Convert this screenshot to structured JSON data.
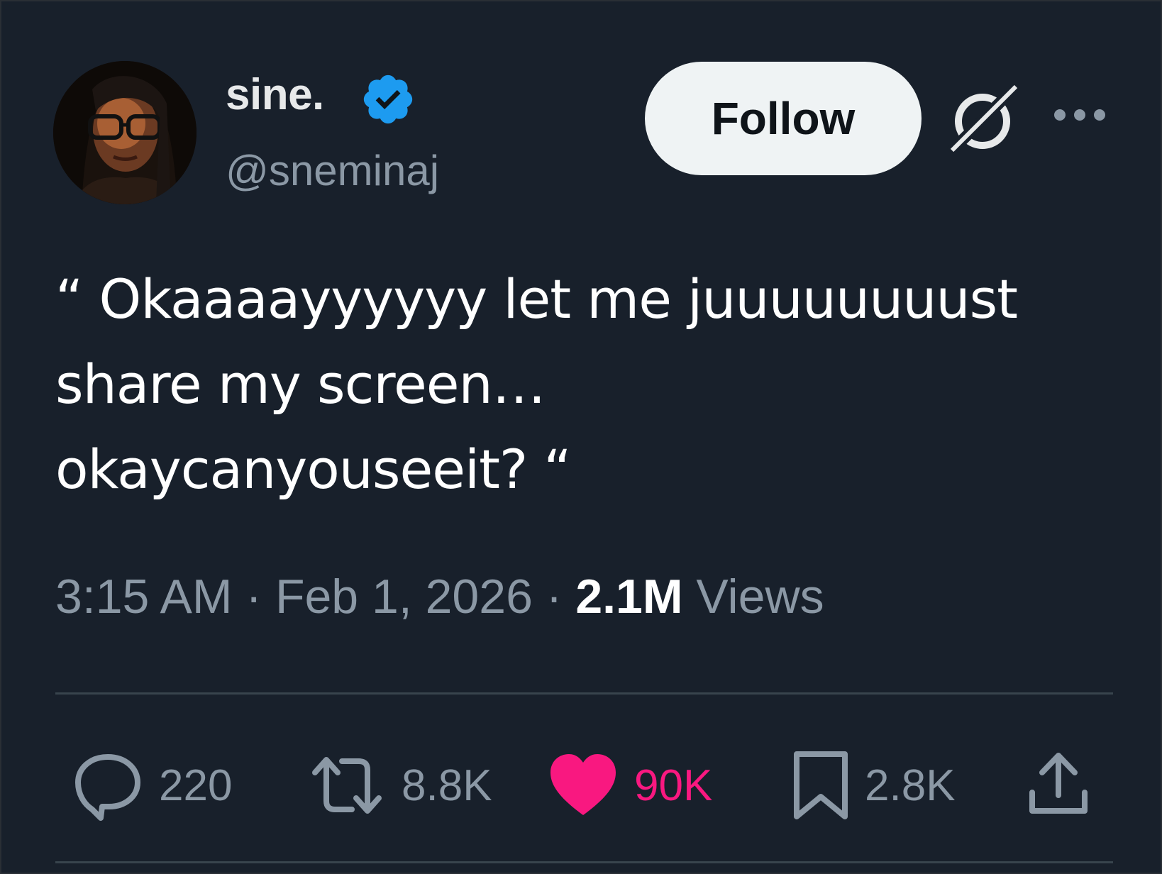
{
  "author": {
    "display_name": "sine.",
    "handle": "@sneminaj",
    "verified_icon": "verified-badge-icon",
    "verified_color": "#1d9bf0"
  },
  "follow_label": "Follow",
  "tweet": {
    "text": "“ Okaaaayyyyyy let me juuuuuuuust\nshare my screen…\nokaycanyouseeit? “"
  },
  "meta": {
    "time": "3:15 AM",
    "sep1": " · ",
    "date": "Feb 1, 2026",
    "sep2": " · ",
    "views_count": "2.1M",
    "views_label": " Views"
  },
  "actions": {
    "replies": {
      "icon": "reply-icon",
      "count": "220"
    },
    "retweets": {
      "icon": "retweet-icon",
      "count": "8.8K"
    },
    "likes": {
      "icon": "heart-icon",
      "count": "90K",
      "color": "#f91880"
    },
    "bookmarks": {
      "icon": "bookmark-icon",
      "count": "2.8K"
    },
    "share": {
      "icon": "share-icon"
    }
  },
  "colors": {
    "background": "#18202b",
    "text_primary": "#e7e9ea",
    "text_secondary": "#8b98a5",
    "divider": "#38444d"
  }
}
